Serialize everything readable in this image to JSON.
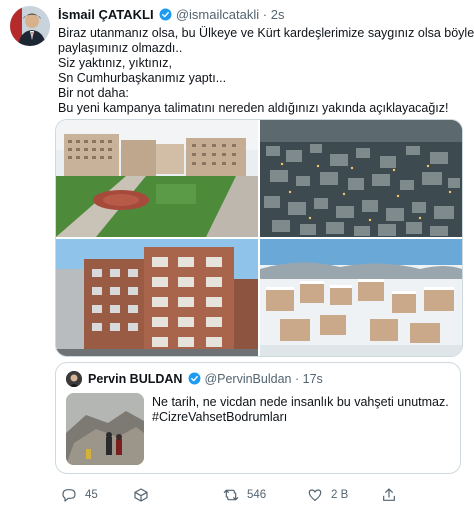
{
  "tweet": {
    "author_name": "İsmail ÇATAKLI",
    "author_handle": "@ismailcatakli",
    "separator": "·",
    "time": "2s",
    "lines": [
      "Biraz utanmanız olsa, bu Ülkeye ve Kürt kardeşlerimize saygınız olsa böyle bir",
      "paylaşımınız olmazdı..",
      "Siz yaktınız, yıktınız,",
      "Sn Cumhurbaşkanımız yaptı...",
      "Bir not daha:",
      "Bu yeni kampanya talimatını  nereden aldığınızı yakında açıklayacağız!"
    ]
  },
  "media": [
    {
      "icon": "photo-new-housing-complex"
    },
    {
      "icon": "photo-city-aerial-evening"
    },
    {
      "icon": "photo-brick-apartment-blocks"
    },
    {
      "icon": "photo-snowy-housing-aerial"
    }
  ],
  "quoted": {
    "author_name": "Pervin BULDAN",
    "author_handle": "@PervinBuldan",
    "separator": "·",
    "time": "17s",
    "text_line1": "Ne tarih, ne vicdan nede insanlık bu vahşeti unutmaz.",
    "hashtag": "#CizreVahsetBodrumları"
  },
  "actions": {
    "reply_count": "45",
    "retweet_count": "546",
    "like_count": "2 B"
  },
  "colors": {
    "verified": "#1d9bf0",
    "secondary_text": "#536471",
    "border": "#cfd9de"
  }
}
